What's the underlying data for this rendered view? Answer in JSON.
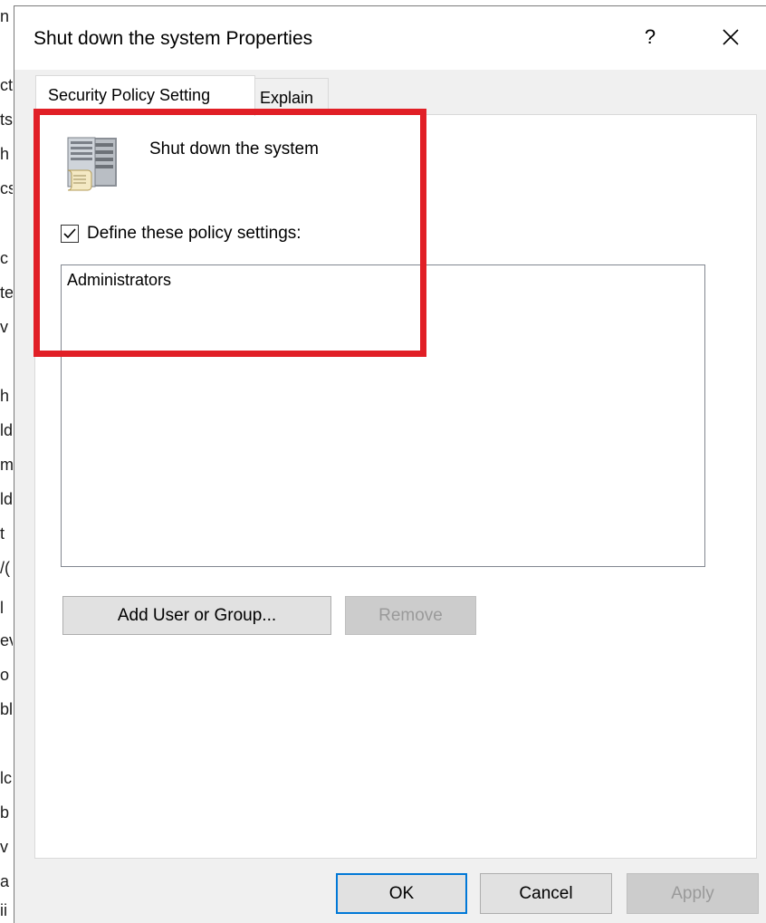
{
  "background_fragments": [
    "n",
    "ct",
    "ts",
    "h",
    "cs",
    "c",
    "te",
    "v",
    "h",
    "ld",
    "m",
    "ld",
    "t",
    "/(",
    "l",
    "ev",
    "o",
    "bl",
    "lc",
    "b",
    "v",
    "a",
    "ii"
  ],
  "dialog": {
    "title": "Shut down the system Properties",
    "help_label": "?",
    "close_label": "✕"
  },
  "tabs": [
    {
      "label": "Security Policy Setting",
      "active": true
    },
    {
      "label": "Explain",
      "active": false
    }
  ],
  "policy": {
    "icon": "server-policy-icon",
    "name": "Shut down the system",
    "define_checked": true,
    "define_label": "Define these policy settings:",
    "members": [
      "Administrators"
    ]
  },
  "buttons": {
    "add": "Add User or Group...",
    "remove": "Remove",
    "ok": "OK",
    "cancel": "Cancel",
    "apply": "Apply"
  },
  "colors": {
    "highlight": "#e11f26",
    "default_button_border": "#0078d7"
  }
}
